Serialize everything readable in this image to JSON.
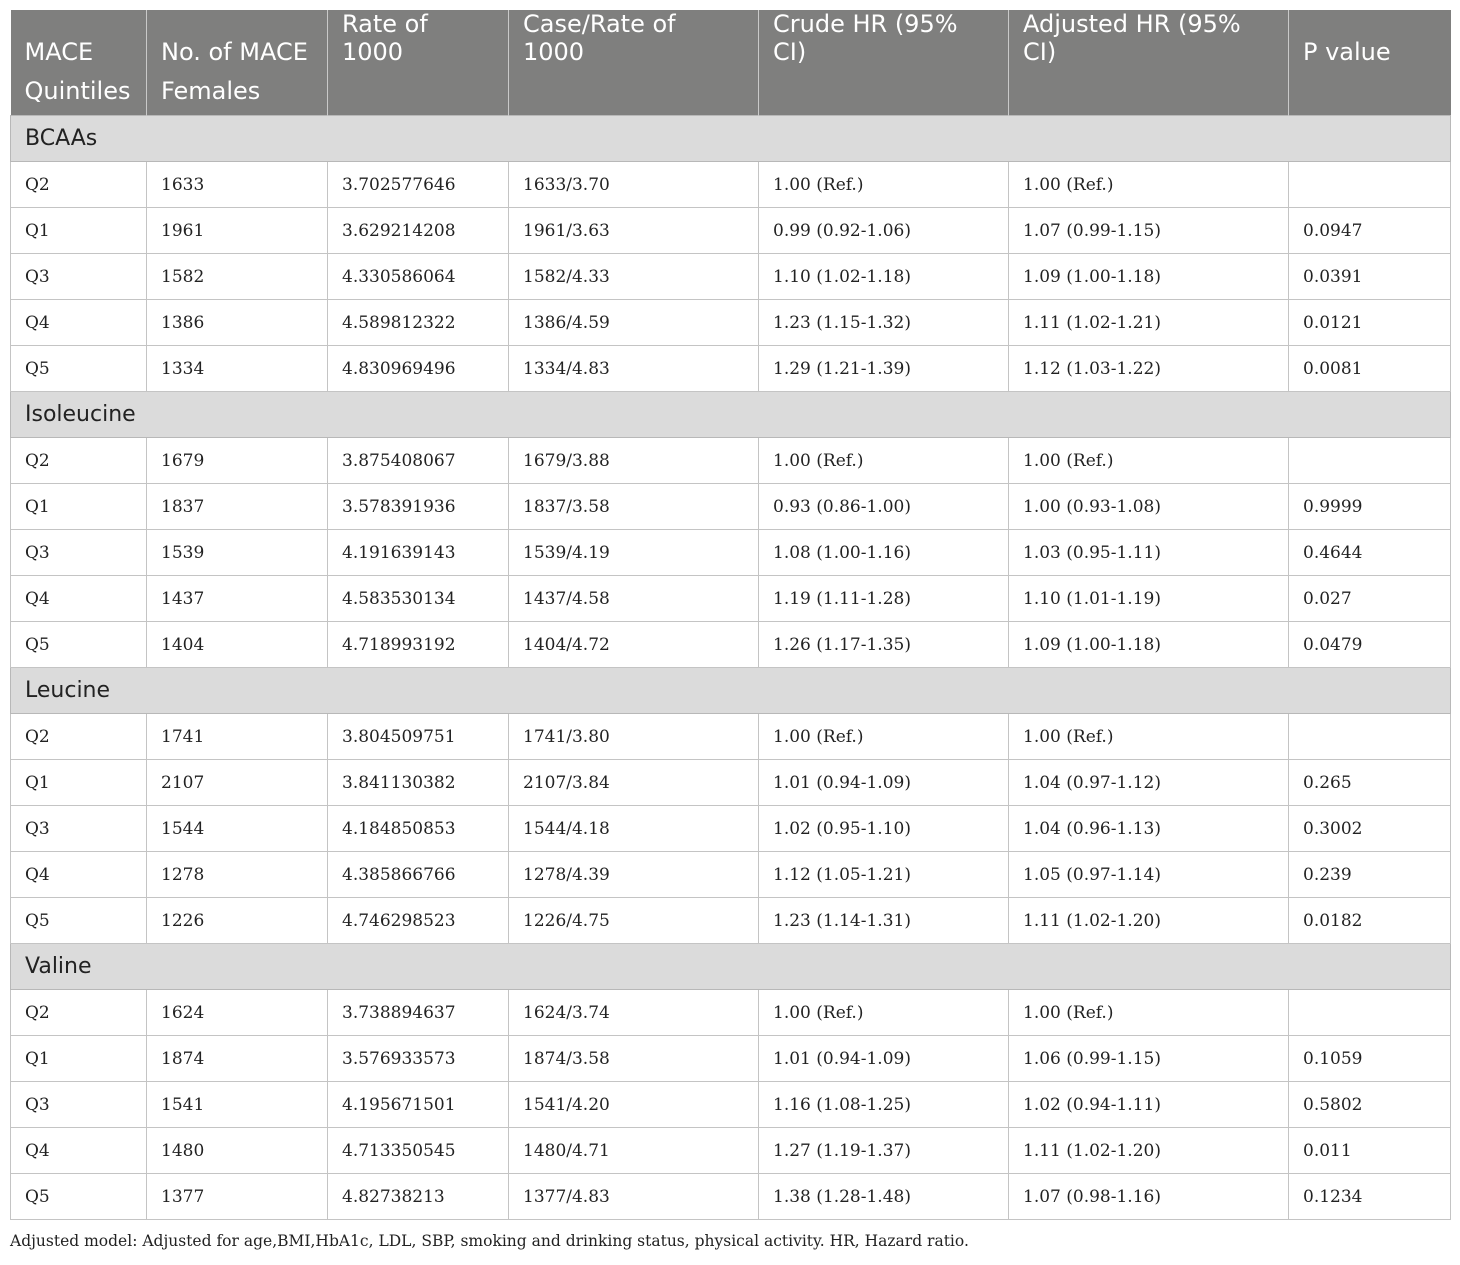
{
  "header": {
    "row1": [
      "MACE",
      "No. of MACE",
      "Rate of 1000",
      "Case/Rate of 1000",
      "Crude HR (95% CI)",
      "Adjusted HR (95% CI)",
      "P value"
    ],
    "row2": [
      "Quintiles",
      "Females",
      "",
      "",
      "",
      "",
      ""
    ]
  },
  "groups": [
    {
      "name": "BCAAs",
      "rows": [
        [
          "Q2",
          "1633",
          "3.702577646",
          "1633/3.70",
          "1.00 (Ref.)",
          "1.00 (Ref.)",
          ""
        ],
        [
          "Q1",
          "1961",
          "3.629214208",
          "1961/3.63",
          "0.99 (0.92-1.06)",
          "1.07 (0.99-1.15)",
          "0.0947"
        ],
        [
          "Q3",
          "1582",
          "4.330586064",
          "1582/4.33",
          "1.10 (1.02-1.18)",
          "1.09 (1.00-1.18)",
          "0.0391"
        ],
        [
          "Q4",
          "1386",
          "4.589812322",
          "1386/4.59",
          "1.23 (1.15-1.32)",
          "1.11 (1.02-1.21)",
          "0.0121"
        ],
        [
          "Q5",
          "1334",
          "4.830969496",
          "1334/4.83",
          "1.29 (1.21-1.39)",
          "1.12 (1.03-1.22)",
          "0.0081"
        ]
      ]
    },
    {
      "name": "Isoleucine",
      "rows": [
        [
          "Q2",
          "1679",
          "3.875408067",
          "1679/3.88",
          "1.00 (Ref.)",
          "1.00 (Ref.)",
          ""
        ],
        [
          "Q1",
          "1837",
          "3.578391936",
          "1837/3.58",
          "0.93 (0.86-1.00)",
          "1.00 (0.93-1.08)",
          "0.9999"
        ],
        [
          "Q3",
          "1539",
          "4.191639143",
          "1539/4.19",
          "1.08 (1.00-1.16)",
          "1.03 (0.95-1.11)",
          "0.4644"
        ],
        [
          "Q4",
          "1437",
          "4.583530134",
          "1437/4.58",
          "1.19 (1.11-1.28)",
          "1.10 (1.01-1.19)",
          "0.027"
        ],
        [
          "Q5",
          "1404",
          "4.718993192",
          "1404/4.72",
          "1.26 (1.17-1.35)",
          "1.09 (1.00-1.18)",
          "0.0479"
        ]
      ]
    },
    {
      "name": "Leucine",
      "rows": [
        [
          "Q2",
          "1741",
          "3.804509751",
          "1741/3.80",
          "1.00 (Ref.)",
          "1.00 (Ref.)",
          ""
        ],
        [
          "Q1",
          "2107",
          "3.841130382",
          "2107/3.84",
          "1.01 (0.94-1.09)",
          "1.04 (0.97-1.12)",
          "0.265"
        ],
        [
          "Q3",
          "1544",
          "4.184850853",
          "1544/4.18",
          "1.02 (0.95-1.10)",
          "1.04 (0.96-1.13)",
          "0.3002"
        ],
        [
          "Q4",
          "1278",
          "4.385866766",
          "1278/4.39",
          "1.12 (1.05-1.21)",
          "1.05 (0.97-1.14)",
          "0.239"
        ],
        [
          "Q5",
          "1226",
          "4.746298523",
          "1226/4.75",
          "1.23 (1.14-1.31)",
          "1.11 (1.02-1.20)",
          "0.0182"
        ]
      ]
    },
    {
      "name": "Valine",
      "rows": [
        [
          "Q2",
          "1624",
          "3.738894637",
          "1624/3.74",
          "1.00 (Ref.)",
          "1.00 (Ref.)",
          ""
        ],
        [
          "Q1",
          "1874",
          "3.576933573",
          "1874/3.58",
          "1.01 (0.94-1.09)",
          "1.06 (0.99-1.15)",
          "0.1059"
        ],
        [
          "Q3",
          "1541",
          "4.195671501",
          "1541/4.20",
          "1.16 (1.08-1.25)",
          "1.02 (0.94-1.11)",
          "0.5802"
        ],
        [
          "Q4",
          "1480",
          "4.713350545",
          "1480/4.71",
          "1.27 (1.19-1.37)",
          "1.11 (1.02-1.20)",
          "0.011"
        ],
        [
          "Q5",
          "1377",
          "4.82738213",
          "1377/4.83",
          "1.38 (1.28-1.48)",
          "1.07 (0.98-1.16)",
          "0.1234"
        ]
      ]
    }
  ],
  "footnote": "Adjusted model: Adjusted for age,BMI,HbA1c, LDL, SBP, smoking and drinking status, physical activity. HR, Hazard ratio."
}
